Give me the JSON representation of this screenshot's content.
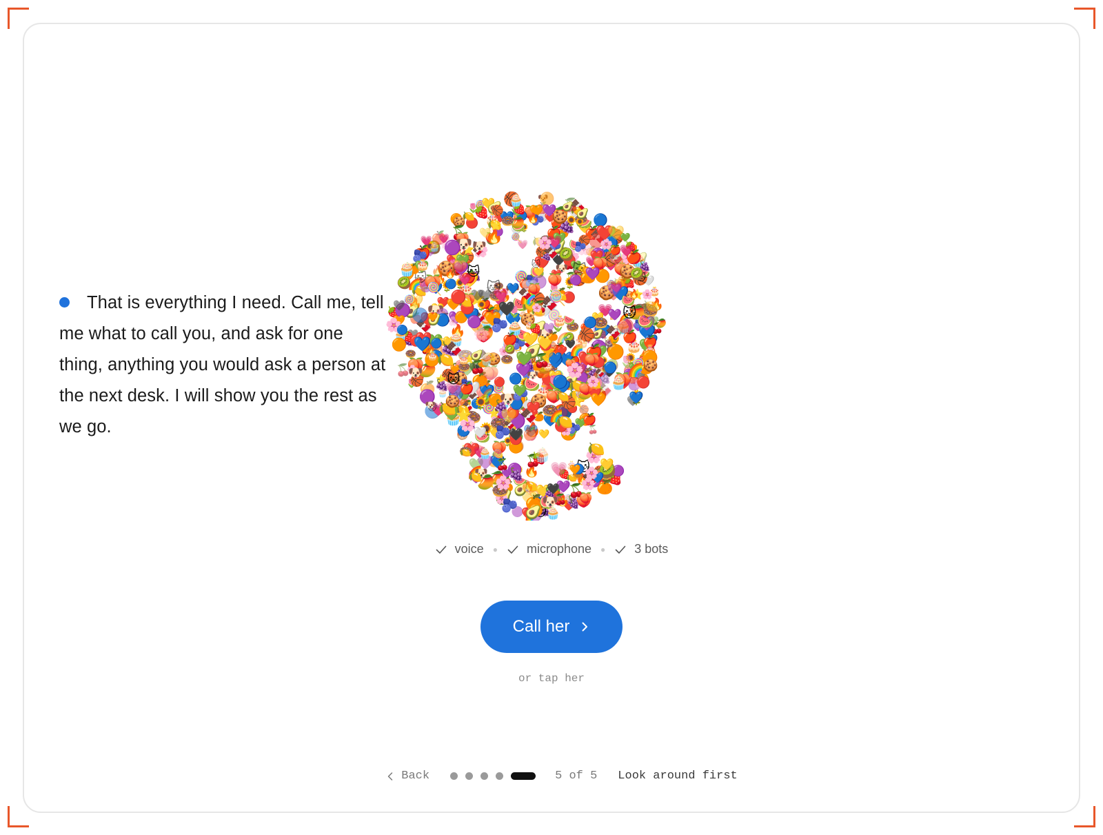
{
  "message": {
    "status_color": "#1f72dc",
    "text": "That is everything I need. Call me, tell me what to call you, and ask for one thing, anything you would ask a person at the next desk. I will show you the rest as we go."
  },
  "avatar": {
    "icon": "emoji-mosaic-face",
    "emojis": [
      "🍎",
      "❤️",
      "💙",
      "💜",
      "🧡",
      "💛",
      "💚",
      "🖤",
      "🤍",
      "🌈",
      "⭐",
      "🍊",
      "🍑",
      "🌸",
      "🍩",
      "🧁",
      "🎂",
      "🍓",
      "🥝",
      "🍇",
      "🔥",
      "🏀",
      "🐱",
      "🐶",
      "🌻",
      "🍒",
      "🍋",
      "🥑",
      "🍉",
      "🍭",
      "💗",
      "🫐",
      "🟣",
      "🔴",
      "🟠",
      "🔵",
      "🍪",
      "🌷",
      "🥭",
      "🍫"
    ]
  },
  "checks": [
    {
      "icon": "check-icon",
      "label": "voice"
    },
    {
      "icon": "check-icon",
      "label": "microphone"
    },
    {
      "icon": "check-icon",
      "label": "3 bots"
    }
  ],
  "cta": {
    "label": "Call her",
    "icon": "chevron-right-icon",
    "color": "#1f73dc",
    "hint": "or tap her"
  },
  "footer": {
    "back_label": "Back",
    "step_count": 5,
    "current_step": 5,
    "page_label": "5 of 5",
    "skip_label": "Look around first"
  },
  "accent": "#e8572a"
}
